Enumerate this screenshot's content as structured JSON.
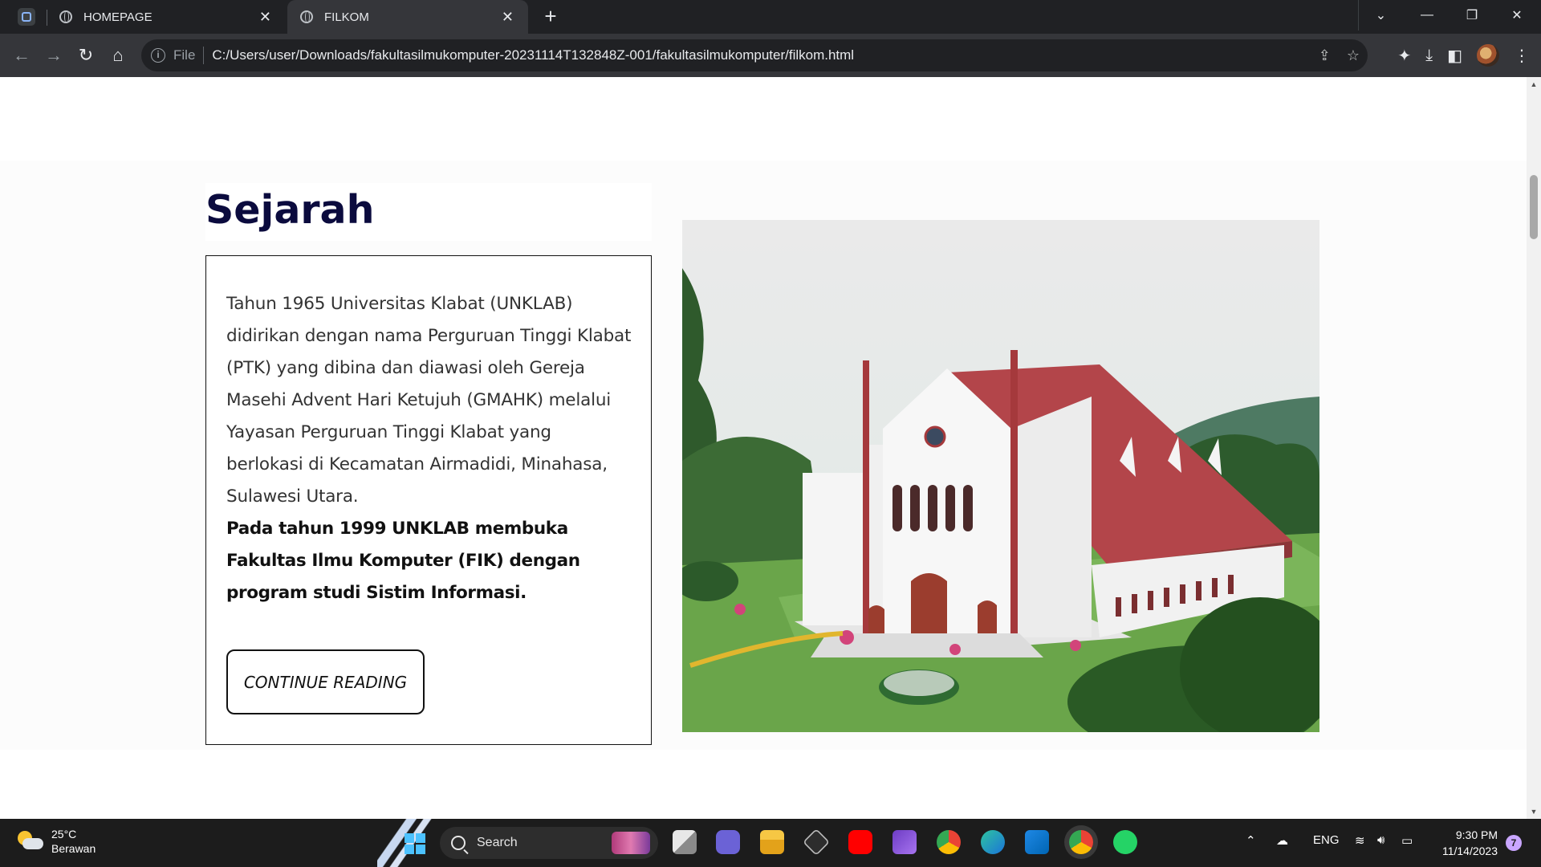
{
  "browser": {
    "tabs": [
      {
        "title": "HOMEPAGE",
        "active": false
      },
      {
        "title": "FILKOM",
        "active": true
      }
    ],
    "new_tab": "+",
    "omnibox": {
      "scheme_label": "File",
      "url": "C:/Users/user/Downloads/fakultasilmukomputer-20231114T132848Z-001/fakultasilmukomputer/filkom.html"
    }
  },
  "page": {
    "heading": "Sejarah",
    "paragraph": "Tahun 1965 Universitas Klabat (UNKLAB) didirikan dengan nama Perguruan Tinggi Klabat (PTK) yang dibina dan diawasi oleh Gereja Masehi Advent Hari Ketujuh (GMAHK) melalui Yayasan Perguruan Tinggi Klabat yang berlokasi di Kecamatan Airmadidi, Minahasa, Sulawesi Utara.",
    "paragraph_bold": "Pada tahun 1999 UNKLAB membuka Fakultas Ilmu Komputer (FIK) dengan program studi Sistim Informasi.",
    "cta_label": "CONTINUE READING",
    "heading_color": "#0b0b3e"
  },
  "taskbar": {
    "weather_temp": "25°C",
    "weather_desc": "Berawan",
    "search_label": "Search",
    "language": "ENG",
    "time": "9:30 PM",
    "date": "11/14/2023",
    "notification_count": "7"
  }
}
